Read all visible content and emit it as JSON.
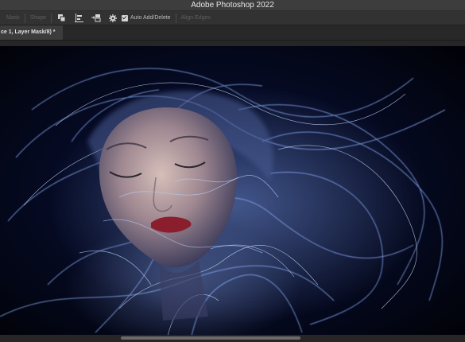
{
  "window": {
    "title": "Adobe Photoshop 2022"
  },
  "options_bar": {
    "mask_label": "Mask",
    "shape_label": "Shape",
    "auto_add_delete_label": "Auto Add/Delete",
    "auto_add_delete_checked": true,
    "align_edges_label": "Align Edges",
    "icons": [
      "path-operations-icon",
      "path-alignment-icon",
      "path-arrangement-icon",
      "gear-icon"
    ]
  },
  "document": {
    "tab_title": "ce 1, Layer Mask/8) *"
  },
  "colors": {
    "ui_dark": "#323232",
    "title_bar": "#3d3d3d",
    "canvas_background": "#02040e",
    "light_trails": "#7fa8ff"
  }
}
